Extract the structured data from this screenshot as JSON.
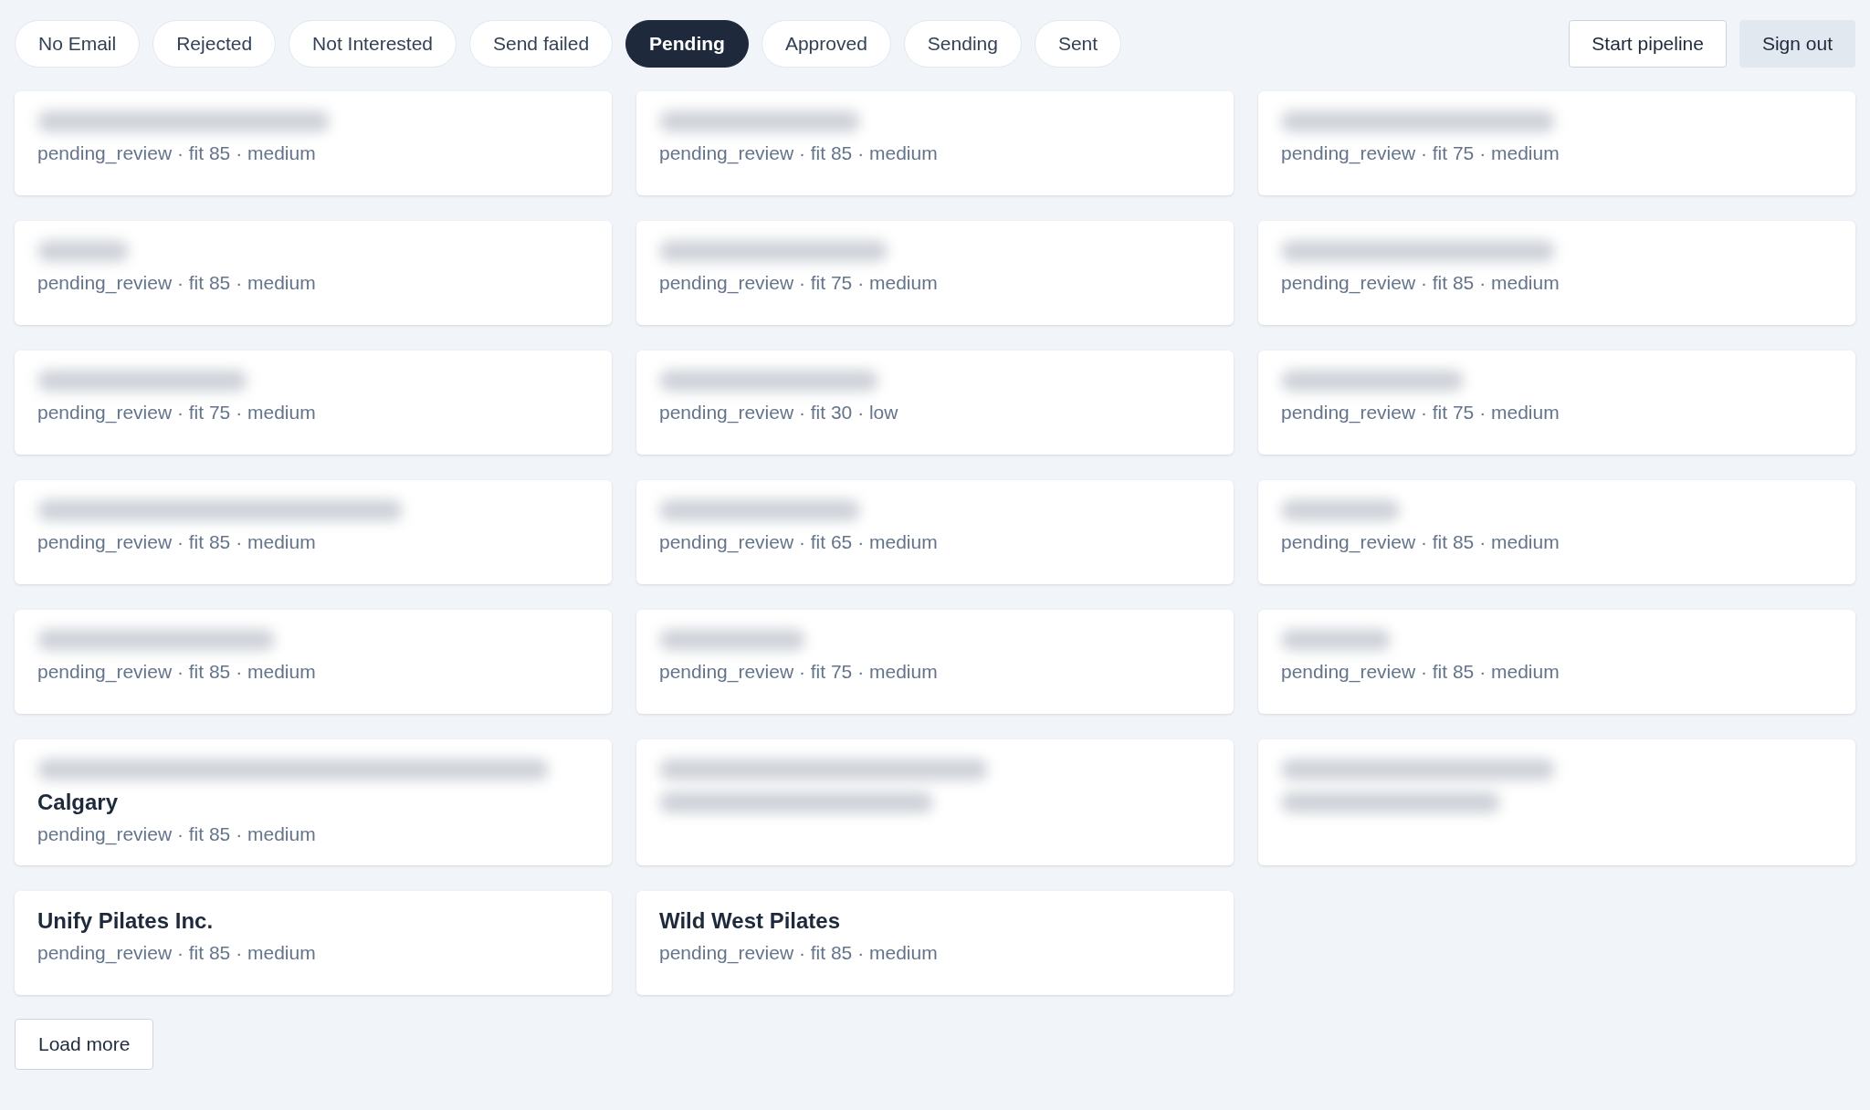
{
  "filters": [
    {
      "label": "No Email",
      "selected": false
    },
    {
      "label": "Rejected",
      "selected": false
    },
    {
      "label": "Not Interested",
      "selected": false
    },
    {
      "label": "Send failed",
      "selected": false
    },
    {
      "label": "Pending",
      "selected": true
    },
    {
      "label": "Approved",
      "selected": false
    },
    {
      "label": "Sending",
      "selected": false
    },
    {
      "label": "Sent",
      "selected": false
    }
  ],
  "actions": [
    {
      "label": "Start pipeline",
      "kind": "outline"
    },
    {
      "label": "Sign out",
      "kind": "muted"
    }
  ],
  "cards": [
    {
      "kind": "blurred",
      "subtitle": "pending_review · fit 85 · medium"
    },
    {
      "kind": "blurred",
      "subtitle": "pending_review · fit 85 · medium"
    },
    {
      "kind": "blurred",
      "subtitle": "pending_review · fit 75 · medium"
    },
    {
      "kind": "blurred",
      "subtitle": "pending_review · fit 85 · medium"
    },
    {
      "kind": "blurred",
      "subtitle": "pending_review · fit 75 · medium"
    },
    {
      "kind": "blurred",
      "subtitle": "pending_review · fit 85 · medium"
    },
    {
      "kind": "blurred",
      "subtitle": "pending_review · fit 75 · medium"
    },
    {
      "kind": "blurred",
      "subtitle": "pending_review · fit 30 · low"
    },
    {
      "kind": "blurred",
      "subtitle": "pending_review · fit 75 · medium"
    },
    {
      "kind": "blurred",
      "subtitle": "pending_review · fit 85 · medium"
    },
    {
      "kind": "blurred",
      "subtitle": "pending_review · fit 65 · medium"
    },
    {
      "kind": "blurred",
      "subtitle": "pending_review · fit 85 · medium"
    },
    {
      "kind": "blurred",
      "subtitle": "pending_review · fit 85 · medium"
    },
    {
      "kind": "blurred",
      "subtitle": "pending_review · fit 75 · medium"
    },
    {
      "kind": "blurred",
      "subtitle": "pending_review · fit 85 · medium"
    },
    {
      "kind": "partly-blurred",
      "title": "Calgary",
      "subtitle": "pending_review · fit 85 · medium"
    },
    {
      "kind": "hidden"
    },
    {
      "kind": "hidden"
    },
    {
      "kind": "plain",
      "title": "Unify Pilates Inc.",
      "subtitle": "pending_review · fit 85 · medium"
    },
    {
      "kind": "plain",
      "title": "Wild West Pilates",
      "subtitle": "pending_review · fit 85 · medium"
    }
  ],
  "load_more": "Load more"
}
